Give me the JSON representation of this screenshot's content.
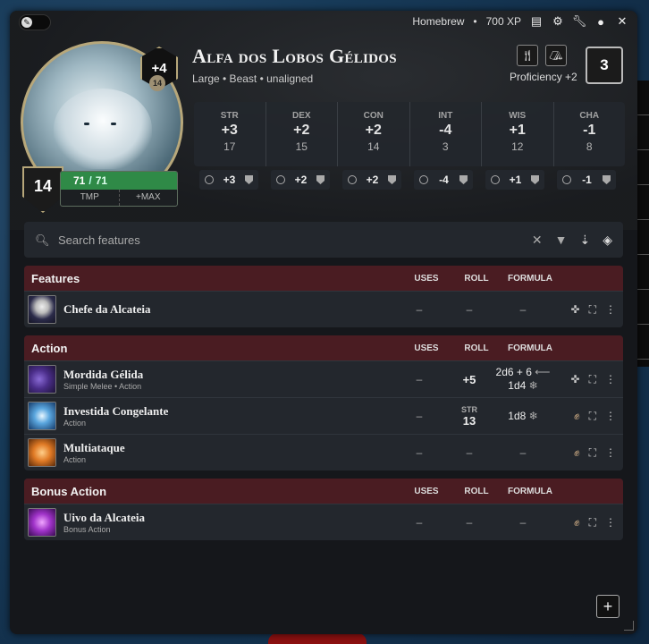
{
  "header": {
    "mode": "Homebrew",
    "xp": "700 XP",
    "icons": [
      "journal-icon",
      "gear-icon",
      "wrench-icon",
      "user-icon",
      "close-icon"
    ]
  },
  "character": {
    "name": "Alfa dos Lobos Gélidos",
    "subtitle": "Large • Beast • unaligned",
    "level_bonus": "+4",
    "level_sub": "14",
    "ac": "14",
    "hp_current": "71",
    "hp_separator": "/",
    "hp_max": "71",
    "hp_tmp_label": "TMP",
    "hp_max_label": "+MAX",
    "proficiency_label": "Proficiency +2",
    "proficiency_box": "3"
  },
  "abilities": [
    {
      "name": "STR",
      "mod": "+3",
      "score": "17",
      "save": "+3"
    },
    {
      "name": "DEX",
      "mod": "+2",
      "score": "15",
      "save": "+2"
    },
    {
      "name": "CON",
      "mod": "+2",
      "score": "14",
      "save": "+2"
    },
    {
      "name": "INT",
      "mod": "-4",
      "score": "3",
      "save": "-4"
    },
    {
      "name": "WIS",
      "mod": "+1",
      "score": "12",
      "save": "+1"
    },
    {
      "name": "CHA",
      "mod": "-1",
      "score": "8",
      "save": "-1"
    }
  ],
  "search": {
    "placeholder": "Search features"
  },
  "columns": {
    "uses": "USES",
    "roll": "ROLL",
    "formula": "FORMULA"
  },
  "sections": {
    "features": {
      "title": "Features",
      "items": [
        {
          "name": "Chefe da Alcateia",
          "sub": "",
          "uses": "–",
          "roll": "–",
          "formula": "–"
        }
      ]
    },
    "action": {
      "title": "Action",
      "items": [
        {
          "name": "Mordida Gélida",
          "sub": "Simple Melee • Action",
          "uses": "–",
          "roll": "+5",
          "formula1": "2d6 + 6",
          "formula2": "1d4"
        },
        {
          "name": "Investida Congelante",
          "sub": "Action",
          "uses": "–",
          "roll_label": "STR",
          "roll": "13",
          "formula": "1d8"
        },
        {
          "name": "Multiataque",
          "sub": "Action",
          "uses": "–",
          "roll": "–",
          "formula": "–"
        }
      ]
    },
    "bonus": {
      "title": "Bonus Action",
      "items": [
        {
          "name": "Uivo da Alcateia",
          "sub": "Bonus Action",
          "uses": "–",
          "roll": "–",
          "formula": "–"
        }
      ]
    }
  },
  "colors": {
    "section_header": "#4a1c22",
    "hp_green": "#2f8a47",
    "panel": "#23272d"
  }
}
